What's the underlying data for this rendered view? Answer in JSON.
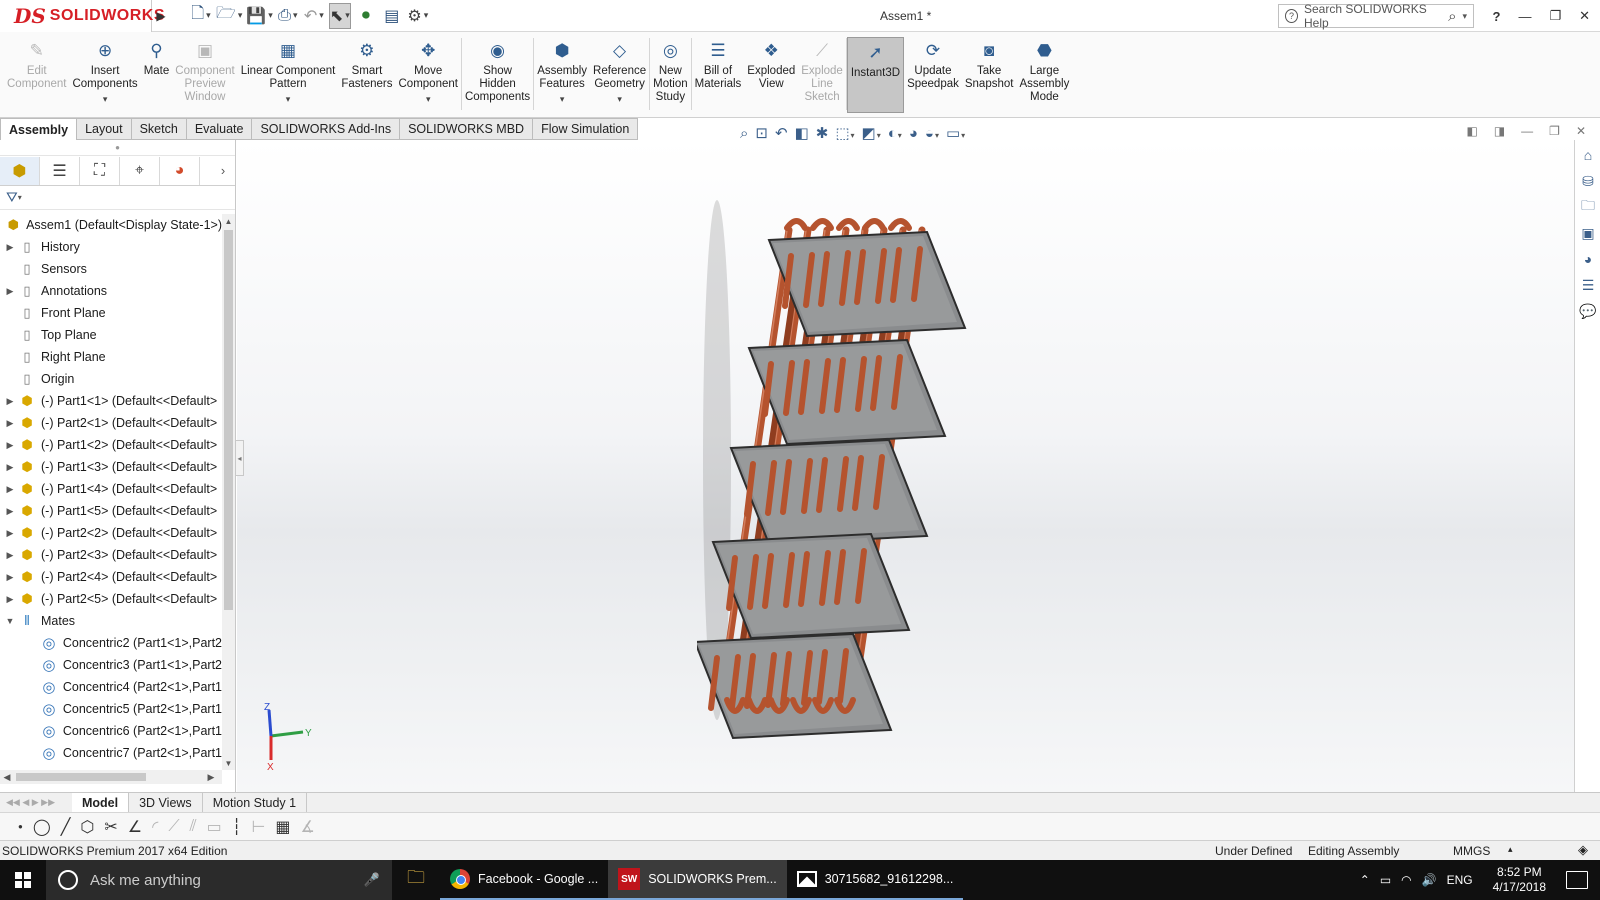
{
  "app": {
    "brand": "SOLIDWORKS",
    "brand_mark": "DS",
    "doc_title": "Assem1 *",
    "search_placeholder": "Search SOLIDWORKS Help",
    "help_label": "?"
  },
  "ribbon": [
    {
      "label": "Edit\nComponent",
      "icon": "edit-component-icon",
      "glyph": "✎",
      "disabled": true
    },
    {
      "label": "Insert\nComponents",
      "icon": "insert-components-icon",
      "glyph": "⊕",
      "dropdown": true
    },
    {
      "label": "Mate",
      "icon": "mate-icon",
      "glyph": "⚲"
    },
    {
      "label": "Component\nPreview\nWindow",
      "icon": "preview-window-icon",
      "glyph": "▣",
      "disabled": true
    },
    {
      "label": "Linear Component\nPattern",
      "icon": "linear-pattern-icon",
      "glyph": "▦",
      "dropdown": true
    },
    {
      "label": "Smart\nFasteners",
      "icon": "smart-fasteners-icon",
      "glyph": "⚙"
    },
    {
      "label": "Move\nComponent",
      "icon": "move-component-icon",
      "glyph": "✥",
      "dropdown": true
    },
    {
      "label": "Show\nHidden\nComponents",
      "icon": "show-hidden-icon",
      "glyph": "◉"
    },
    {
      "label": "Assembly\nFeatures",
      "icon": "assembly-features-icon",
      "glyph": "⬢",
      "dropdown": true
    },
    {
      "label": "Reference\nGeometry",
      "icon": "reference-geometry-icon",
      "glyph": "◇",
      "dropdown": true
    },
    {
      "label": "New\nMotion\nStudy",
      "icon": "motion-study-icon",
      "glyph": "◎"
    },
    {
      "label": "Bill of\nMaterials",
      "icon": "bom-icon",
      "glyph": "☰"
    },
    {
      "label": "Exploded\nView",
      "icon": "exploded-view-icon",
      "glyph": "❖"
    },
    {
      "label": "Explode\nLine\nSketch",
      "icon": "explode-line-icon",
      "glyph": "⟋",
      "disabled": true
    },
    {
      "label": "Instant3D",
      "icon": "instant3d-icon",
      "glyph": "➚",
      "active": true
    },
    {
      "label": "Update\nSpeedpak",
      "icon": "speedpak-icon",
      "glyph": "⟳"
    },
    {
      "label": "Take\nSnapshot",
      "icon": "snapshot-icon",
      "glyph": "◙"
    },
    {
      "label": "Large\nAssembly\nMode",
      "icon": "large-assembly-icon",
      "glyph": "⬣"
    }
  ],
  "cm_tabs": [
    "Assembly",
    "Layout",
    "Sketch",
    "Evaluate",
    "SOLIDWORKS Add-Ins",
    "SOLIDWORKS MBD",
    "Flow Simulation"
  ],
  "active_cm_tab": "Assembly",
  "tree": [
    {
      "label": "Assem1  (Default<Display State-1>)",
      "icon": "assembly-icon",
      "kind": "root",
      "expander": "",
      "indent": 0
    },
    {
      "label": "History",
      "icon": "history-icon",
      "kind": "plane",
      "expander": "▶",
      "indent": 1
    },
    {
      "label": "Sensors",
      "icon": "sensors-icon",
      "kind": "plane",
      "expander": "",
      "indent": 1
    },
    {
      "label": "Annotations",
      "icon": "annotations-icon",
      "kind": "plane",
      "expander": "▶",
      "indent": 1
    },
    {
      "label": "Front Plane",
      "icon": "plane-icon",
      "kind": "plane",
      "expander": "",
      "indent": 1
    },
    {
      "label": "Top Plane",
      "icon": "plane-icon",
      "kind": "plane",
      "expander": "",
      "indent": 1
    },
    {
      "label": "Right Plane",
      "icon": "plane-icon",
      "kind": "plane",
      "expander": "",
      "indent": 1
    },
    {
      "label": "Origin",
      "icon": "origin-icon",
      "kind": "plane",
      "expander": "",
      "indent": 1
    },
    {
      "label": "(-) Part1<1> (Default<<Default>",
      "icon": "part-icon",
      "kind": "part",
      "expander": "▶",
      "indent": 1
    },
    {
      "label": "(-) Part2<1> (Default<<Default>",
      "icon": "part-icon",
      "kind": "part",
      "expander": "▶",
      "indent": 1
    },
    {
      "label": "(-) Part1<2> (Default<<Default>",
      "icon": "part-icon",
      "kind": "part",
      "expander": "▶",
      "indent": 1
    },
    {
      "label": "(-) Part1<3> (Default<<Default>",
      "icon": "part-icon",
      "kind": "part",
      "expander": "▶",
      "indent": 1
    },
    {
      "label": "(-) Part1<4> (Default<<Default>",
      "icon": "part-icon",
      "kind": "part",
      "expander": "▶",
      "indent": 1
    },
    {
      "label": "(-) Part1<5> (Default<<Default>",
      "icon": "part-icon",
      "kind": "part",
      "expander": "▶",
      "indent": 1
    },
    {
      "label": "(-) Part2<2> (Default<<Default>",
      "icon": "part-icon",
      "kind": "part",
      "expander": "▶",
      "indent": 1
    },
    {
      "label": "(-) Part2<3> (Default<<Default>",
      "icon": "part-icon",
      "kind": "part",
      "expander": "▶",
      "indent": 1
    },
    {
      "label": "(-) Part2<4> (Default<<Default>",
      "icon": "part-icon",
      "kind": "part",
      "expander": "▶",
      "indent": 1
    },
    {
      "label": "(-) Part2<5> (Default<<Default>",
      "icon": "part-icon",
      "kind": "part",
      "expander": "▶",
      "indent": 1
    },
    {
      "label": "Mates",
      "icon": "mates-icon",
      "kind": "mate",
      "expander": "▼",
      "indent": 1
    },
    {
      "label": "Concentric2 (Part1<1>,Part2",
      "icon": "concentric-icon",
      "kind": "conc",
      "expander": "",
      "indent": 2
    },
    {
      "label": "Concentric3 (Part1<1>,Part2",
      "icon": "concentric-icon",
      "kind": "conc",
      "expander": "",
      "indent": 2
    },
    {
      "label": "Concentric4 (Part2<1>,Part1",
      "icon": "concentric-icon",
      "kind": "conc",
      "expander": "",
      "indent": 2
    },
    {
      "label": "Concentric5 (Part2<1>,Part1",
      "icon": "concentric-icon",
      "kind": "conc",
      "expander": "",
      "indent": 2
    },
    {
      "label": "Concentric6 (Part2<1>,Part1",
      "icon": "concentric-icon",
      "kind": "conc",
      "expander": "",
      "indent": 2
    },
    {
      "label": "Concentric7 (Part2<1>,Part1",
      "icon": "concentric-icon",
      "kind": "conc",
      "expander": "",
      "indent": 2
    }
  ],
  "triad": {
    "x": "X",
    "y": "Y",
    "z": "Z"
  },
  "bottom_tabs": [
    "Model",
    "3D Views",
    "Motion Study 1"
  ],
  "active_bottom_tab": "Model",
  "status": {
    "edition": "SOLIDWORKS Premium 2017 x64 Edition",
    "definition": "Under Defined",
    "mode": "Editing Assembly",
    "units": "MMGS"
  },
  "taskbar": {
    "search": "Ask me anything",
    "apps": [
      "Facebook - Google ...",
      "SOLIDWORKS Prem...",
      "30715682_91612298..."
    ],
    "lang": "ENG",
    "time": "8:52 PM",
    "date": "4/17/2018"
  },
  "colors": {
    "brand_red": "#d61f26",
    "copper": "#b5532e",
    "plate": "#8a8c8e",
    "taskbar": "#101010"
  }
}
